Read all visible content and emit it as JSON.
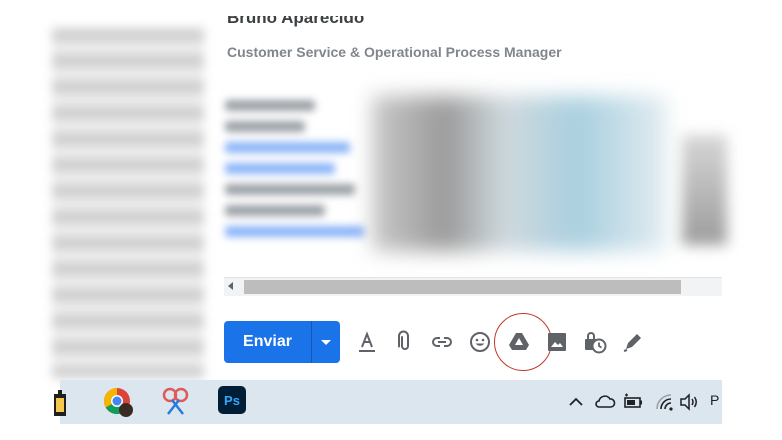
{
  "signature": {
    "name": "Bruno Aparecido",
    "title": "Customer Service & Operational Process Manager"
  },
  "compose_toolbar": {
    "send_label": "Enviar",
    "send_options_icon": "chevron-down-icon",
    "tools": [
      {
        "name": "formatting-options-icon",
        "label": "Formatting options"
      },
      {
        "name": "attach-files-icon",
        "label": "Attach files"
      },
      {
        "name": "insert-link-icon",
        "label": "Insert link"
      },
      {
        "name": "insert-emoji-icon",
        "label": "Insert emoji"
      },
      {
        "name": "google-drive-icon",
        "label": "Insert files using Drive"
      },
      {
        "name": "insert-photo-icon",
        "label": "Insert photo"
      },
      {
        "name": "confidential-mode-icon",
        "label": "Toggle confidential mode"
      },
      {
        "name": "insert-signature-icon",
        "label": "Insert signature"
      }
    ],
    "highlighted_tool": "google-drive-icon",
    "highlight_color": "#c0392b"
  },
  "taskbar": {
    "apps": [
      "file-explorer-icon",
      "chrome-icon",
      "snipping-tool-icon",
      "photoshop-icon"
    ],
    "photoshop_label": "Ps",
    "tray": [
      "show-hidden-icons-icon",
      "onedrive-icon",
      "battery-icon",
      "wifi-icon",
      "volume-icon"
    ],
    "language_cut": "P"
  },
  "colors": {
    "accent": "#1a73e8",
    "taskbar_bg": "#dbe6ef",
    "toolbar_icon": "#5f6368"
  }
}
